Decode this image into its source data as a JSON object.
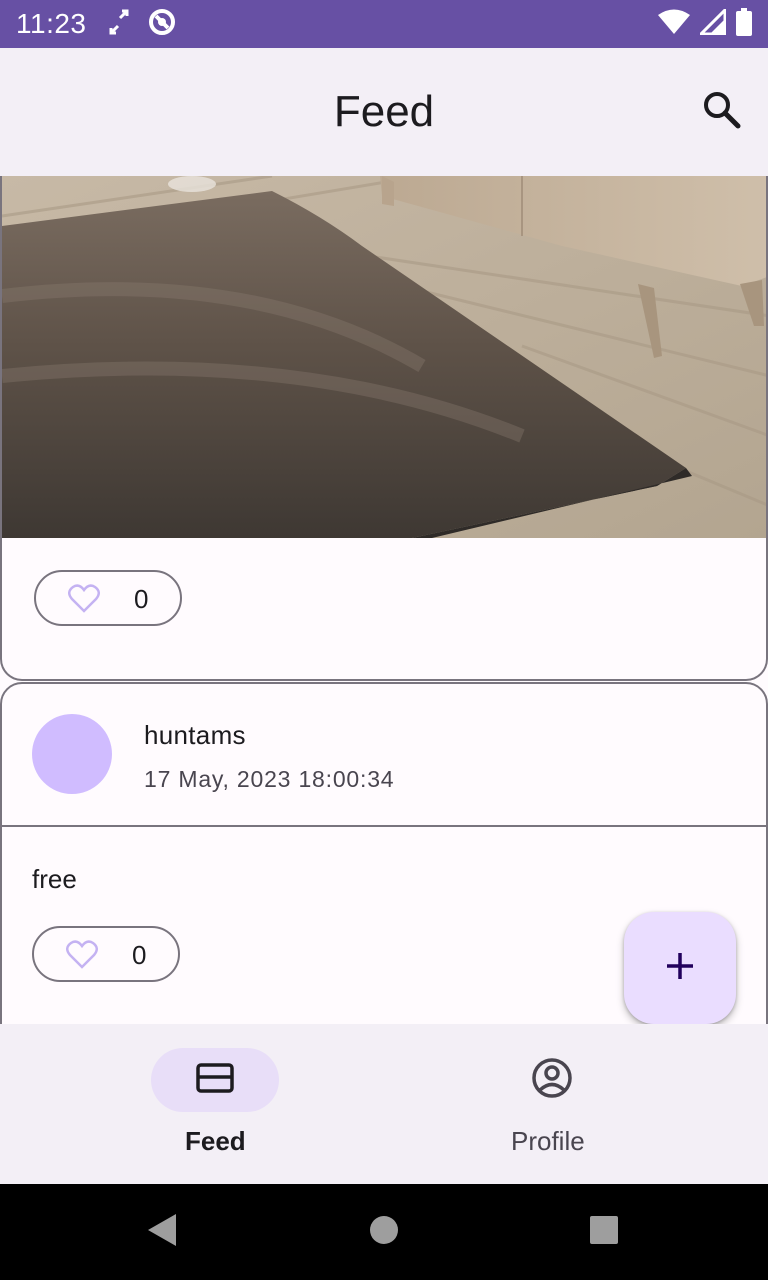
{
  "status_bar": {
    "time": "11:23",
    "icons": [
      "sync-icon",
      "no-disturb-icon",
      "wifi-icon",
      "signal-icon",
      "battery-icon"
    ]
  },
  "app_bar": {
    "title": "Feed",
    "search_icon": "search-icon"
  },
  "feed": {
    "posts": [
      {
        "image_description_icon": "post-photo",
        "likes": "0"
      },
      {
        "author": "huntams",
        "date": "17 May, 2023 18:00:34",
        "text": "free",
        "likes": "0"
      }
    ]
  },
  "fab": {
    "icon": "plus-icon"
  },
  "bottom_nav": {
    "items": [
      {
        "label": "Feed",
        "icon": "feed-card-icon",
        "selected": true
      },
      {
        "label": "Profile",
        "icon": "account-circle-icon",
        "selected": false
      }
    ]
  },
  "colors": {
    "primary": "#6750a4",
    "surface": "#fffbfe",
    "surface_container": "#f3eff6",
    "secondary_container": "#e8def8",
    "primary_container": "#eaddff",
    "avatar": "#d0bcff",
    "outline": "#79747e"
  }
}
